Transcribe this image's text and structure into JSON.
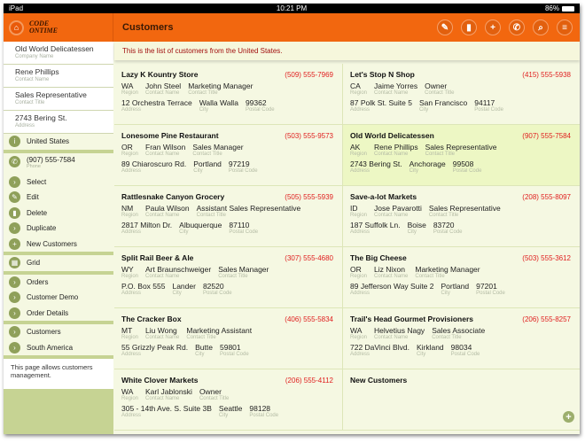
{
  "status": {
    "device": "iPad",
    "time": "10:21 PM",
    "battery": "86%"
  },
  "header": {
    "logo": "CODE ONTIME",
    "title": "Customers",
    "tools": [
      {
        "icon": "edit-icon",
        "glyph": "✎"
      },
      {
        "icon": "delete-icon",
        "glyph": "▮"
      },
      {
        "icon": "add-icon",
        "glyph": "+"
      },
      {
        "icon": "phone-icon",
        "glyph": "✆"
      },
      {
        "icon": "search-icon",
        "glyph": "⌕"
      },
      {
        "icon": "menu-icon",
        "glyph": "≡"
      }
    ]
  },
  "sidebar": {
    "fields": [
      {
        "value": "Old World Delicatessen",
        "label": "Company Name"
      },
      {
        "value": "Rene Phillips",
        "label": "Contact Name"
      },
      {
        "value": "Sales Representative",
        "label": "Contact Title"
      },
      {
        "value": "2743 Bering St.",
        "label": "Address"
      }
    ],
    "country": "United States",
    "phone": {
      "value": "(907) 555-7584",
      "label": "Phone"
    },
    "actions": [
      "Select",
      "Edit",
      "Delete",
      "Duplicate",
      "New Customers"
    ],
    "grid": "Grid",
    "links": [
      "Orders",
      "Customer Demo",
      "Order Details"
    ],
    "nav": [
      "Customers",
      "South America"
    ],
    "note": "This page allows customers management."
  },
  "main": {
    "message": "This is the list of customers from the United States.",
    "labels": {
      "region": "Region",
      "contact": "Contact Name",
      "title": "Contact Title",
      "address": "Address",
      "city": "City",
      "postal": "Postal Code"
    },
    "cards": [
      {
        "name": "Lazy K Kountry Store",
        "phone": "(509) 555-7969",
        "region": "WA",
        "contact": "John Steel",
        "title": "Marketing Manager",
        "address": "12 Orchestra Terrace",
        "city": "Walla Walla",
        "postal": "99362"
      },
      {
        "name": "Let's Stop N Shop",
        "phone": "(415) 555-5938",
        "region": "CA",
        "contact": "Jaime Yorres",
        "title": "Owner",
        "address": "87 Polk St. Suite 5",
        "city": "San Francisco",
        "postal": "94117"
      },
      {
        "name": "Lonesome Pine Restaurant",
        "phone": "(503) 555-9573",
        "region": "OR",
        "contact": "Fran Wilson",
        "title": "Sales Manager",
        "address": "89 Chiaroscuro Rd.",
        "city": "Portland",
        "postal": "97219"
      },
      {
        "name": "Old World Delicatessen",
        "phone": "(907) 555-7584",
        "region": "AK",
        "contact": "Rene Phillips",
        "title": "Sales Representative",
        "address": "2743 Bering St.",
        "city": "Anchorage",
        "postal": "99508",
        "selected": true
      },
      {
        "name": "Rattlesnake Canyon Grocery",
        "phone": "(505) 555-5939",
        "region": "NM",
        "contact": "Paula Wilson",
        "title": "Assistant Sales Representative",
        "address": "2817 Milton Dr.",
        "city": "Albuquerque",
        "postal": "87110"
      },
      {
        "name": "Save-a-lot Markets",
        "phone": "(208) 555-8097",
        "region": "ID",
        "contact": "Jose Pavarotti",
        "title": "Sales Representative",
        "address": "187 Suffolk Ln.",
        "city": "Boise",
        "postal": "83720"
      },
      {
        "name": "Split Rail Beer & Ale",
        "phone": "(307) 555-4680",
        "region": "WY",
        "contact": "Art Braunschweiger",
        "title": "Sales Manager",
        "address": "P.O. Box 555",
        "city": "Lander",
        "postal": "82520"
      },
      {
        "name": "The Big Cheese",
        "phone": "(503) 555-3612",
        "region": "OR",
        "contact": "Liz Nixon",
        "title": "Marketing Manager",
        "address": "89 Jefferson Way Suite 2",
        "city": "Portland",
        "postal": "97201"
      },
      {
        "name": "The Cracker Box",
        "phone": "(406) 555-5834",
        "region": "MT",
        "contact": "Liu Wong",
        "title": "Marketing Assistant",
        "address": "55 Grizzly Peak Rd.",
        "city": "Butte",
        "postal": "59801"
      },
      {
        "name": "Trail's Head Gourmet Provisioners",
        "phone": "(206) 555-8257",
        "region": "WA",
        "contact": "Helvetius Nagy",
        "title": "Sales Associate",
        "address": "722 DaVinci Blvd.",
        "city": "Kirkland",
        "postal": "98034"
      },
      {
        "name": "White Clover Markets",
        "phone": "(206) 555-4112",
        "region": "WA",
        "contact": "Karl Jablonski",
        "title": "Owner",
        "address": "305 - 14th Ave. S. Suite 3B",
        "city": "Seattle",
        "postal": "98128"
      }
    ],
    "new_label": "New Customers"
  }
}
